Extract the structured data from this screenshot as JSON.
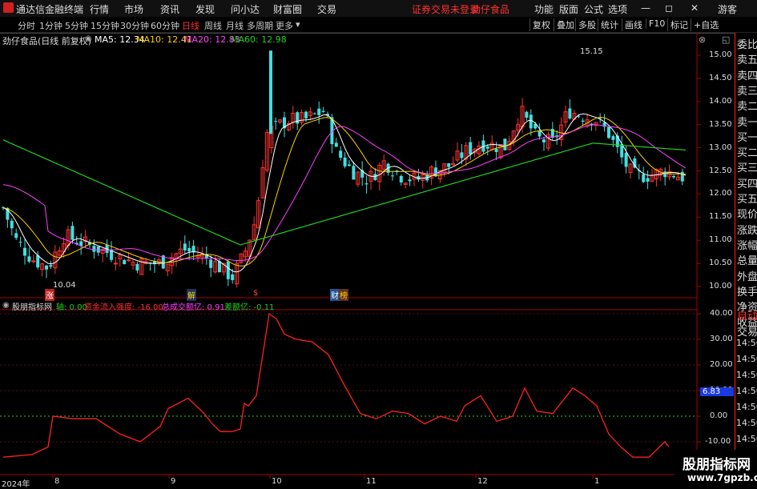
{
  "titlebar": {
    "app_title": "通达信金融终端",
    "menus": [
      "行情",
      "市场",
      "资讯",
      "发现",
      "问小达",
      "财富圈",
      "交易"
    ],
    "status_notice": "证券交易未登录",
    "stock_name": "劲仔食品",
    "right_menus": [
      "功能",
      "版面",
      "公式",
      "选项"
    ],
    "guest": "游客"
  },
  "toolbar": {
    "periods": [
      "分时",
      "1分钟",
      "5分钟",
      "15分钟",
      "30分钟",
      "60分钟",
      "日线",
      "周线",
      "月线",
      "多周期",
      "更多"
    ],
    "active_period": "日线",
    "right_buttons": [
      "复权",
      "叠加",
      "多股",
      "统计",
      "画线",
      "F10",
      "标记",
      "+自选"
    ]
  },
  "main_chart": {
    "title": "劲仔食品(日线 前复权)",
    "ma": [
      {
        "label": "MA5: 12.34",
        "color": "#ffffff"
      },
      {
        "label": "MA10: 12.41",
        "color": "#ffd000"
      },
      {
        "label": "MA20: 12.83",
        "color": "#ff40ff"
      },
      {
        "label": "MA60: 12.98",
        "color": "#20d020"
      }
    ],
    "y_ticks": [
      "15.00",
      "14.50",
      "14.00",
      "13.50",
      "13.00",
      "12.50",
      "12.00",
      "11.50",
      "11.00",
      "10.50",
      "10.00"
    ],
    "high_label": "15.15",
    "low_label": "10.04",
    "markers": [
      "涨",
      "解",
      "$",
      "财",
      "榜"
    ]
  },
  "indicator": {
    "title": "股朋指标网",
    "items": [
      {
        "label": "轴: 0.00",
        "color": "#20d020"
      },
      {
        "label": "资金流入强度: -16.00",
        "color": "#ff3030"
      },
      {
        "label": "总成交额亿: 0.91",
        "color": "#ff40ff"
      },
      {
        "label": "差额亿: -0.11",
        "color": "#20d020"
      }
    ],
    "y_ticks": [
      "40.00",
      "30.00",
      "20.00",
      "10.00",
      "0.00",
      "-10.00"
    ],
    "current_value": "6.83"
  },
  "x_axis": [
    "2024年",
    "8",
    "9",
    "10",
    "11",
    "12",
    "1"
  ],
  "side_panel": [
    "委比",
    "卖五",
    "卖四",
    "卖三",
    "卖二",
    "卖一",
    "买一",
    "买二",
    "买三",
    "买四",
    "买五",
    "现价",
    "涨跌",
    "涨幅",
    "总量",
    "外盘",
    "换手",
    "净资",
    "收益",
    "自动",
    "交易",
    "14:56",
    "14:56",
    "14:56",
    "14:56",
    "14:56",
    "14:56",
    "14:56",
    "14:56"
  ],
  "watermark": {
    "line1": "股朋指标网",
    "line2": "www.7gpzb.com"
  },
  "colors": {
    "up": "#ff3030",
    "down": "#40e0e0",
    "ma5": "#ffffff",
    "ma10": "#ffd000",
    "ma20": "#ff40ff",
    "ma60": "#20d020",
    "axis": "#aa0000"
  }
}
